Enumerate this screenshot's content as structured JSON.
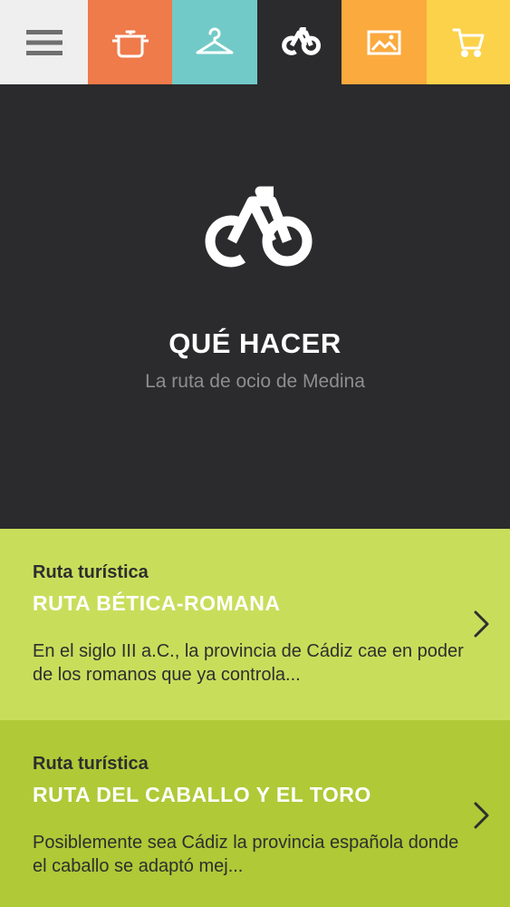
{
  "nav": {
    "tabs": [
      {
        "icon": "hamburger-menu-icon",
        "color": "#efefef"
      },
      {
        "icon": "cooking-pot-icon",
        "color": "#ef7a4a"
      },
      {
        "icon": "clothes-hanger-icon",
        "color": "#72cac8"
      },
      {
        "icon": "bicycle-icon",
        "color": "#2b2a2c",
        "active": true
      },
      {
        "icon": "picture-icon",
        "color": "#fbaa3e"
      },
      {
        "icon": "shopping-cart-icon",
        "color": "#fbd24a"
      }
    ]
  },
  "hero": {
    "icon": "bicycle-icon",
    "title": "QUÉ HACER",
    "subtitle": "La ruta de ocio de Medina",
    "background": "#2b2a2c"
  },
  "routes": [
    {
      "category": "Ruta turística",
      "title": "RUTA BÉTICA-ROMANA",
      "description": "En el siglo III a.C., la provincia de Cádiz cae en poder de los romanos que ya controla...",
      "color": "#c8de5b",
      "icon": "chevron-right-icon"
    },
    {
      "category": "Ruta turística",
      "title": "RUTA DEL CABALLO Y EL TORO",
      "description": "Posiblemente sea Cádiz la provincia española donde el caballo se adaptó mej...",
      "color": "#afc937",
      "icon": "chevron-right-icon"
    }
  ]
}
